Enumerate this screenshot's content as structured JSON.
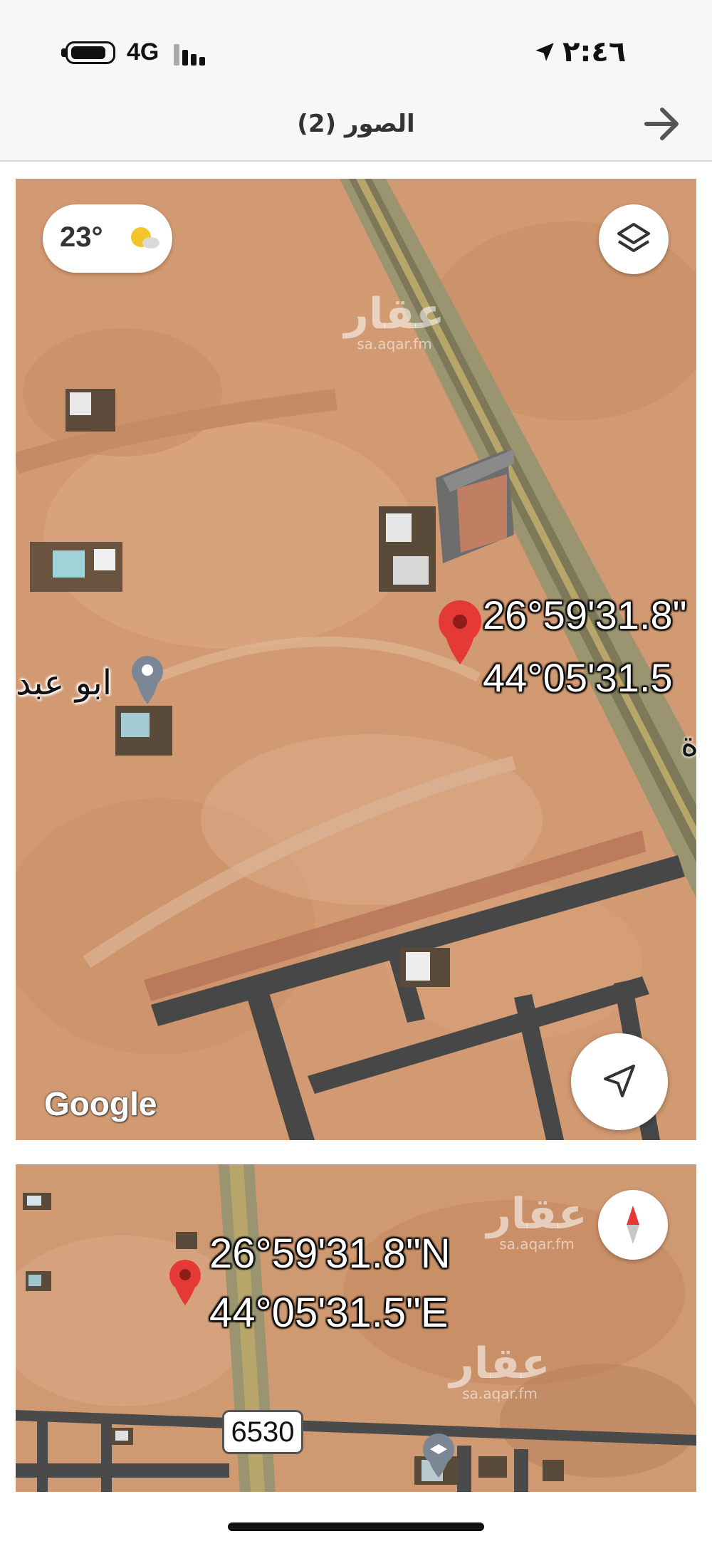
{
  "status_bar": {
    "network": "4G",
    "time": "٢:٤٦"
  },
  "header": {
    "title": "الصور (2)"
  },
  "photo1": {
    "weather_temp": "23°",
    "coord_lat": "26°59'31.8\"",
    "coord_lon": "44°05'31.5",
    "poi_label": "ابو عبد",
    "edge_label": "ة",
    "google_logo": "Google",
    "watermark_text": "عقار",
    "watermark_site": "sa.aqar.fm"
  },
  "photo2": {
    "coord_lat": "26°59'31.8\"N",
    "coord_lon": "44°05'31.5\"E",
    "route_number": "6530",
    "watermark_text": "عقار",
    "watermark_site": "sa.aqar.fm"
  },
  "colors": {
    "desert": "#d29a72",
    "road_asphalt": "#4a4a4a",
    "highway_edge": "#b8a56a",
    "pin_red": "#e53935"
  }
}
